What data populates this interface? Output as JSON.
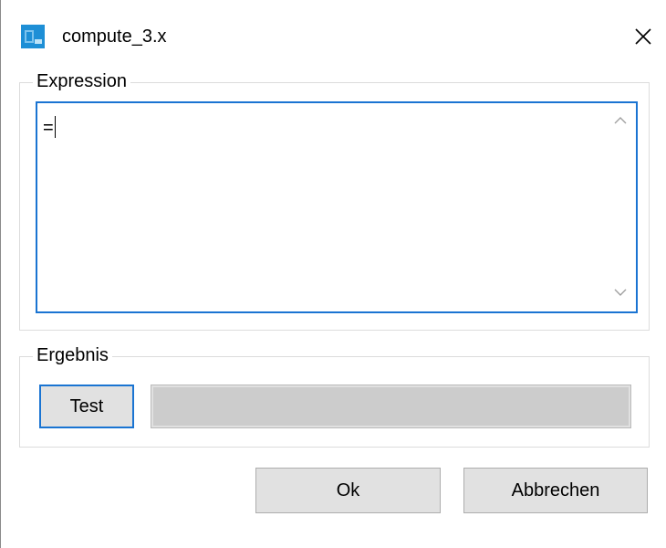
{
  "window": {
    "title": "compute_3.x",
    "icon": "app-window-icon",
    "close_icon": "close-icon"
  },
  "expression_group": {
    "label": "Expression",
    "value": "="
  },
  "result_group": {
    "label": "Ergebnis",
    "test_label": "Test",
    "result_value": ""
  },
  "buttons": {
    "ok_label": "Ok",
    "cancel_label": "Abbrechen"
  },
  "colors": {
    "focus_border": "#1a74d2",
    "button_face": "#e1e1e1",
    "readonly_field": "#cccccc",
    "icon_blue": "#1e8fd6"
  }
}
